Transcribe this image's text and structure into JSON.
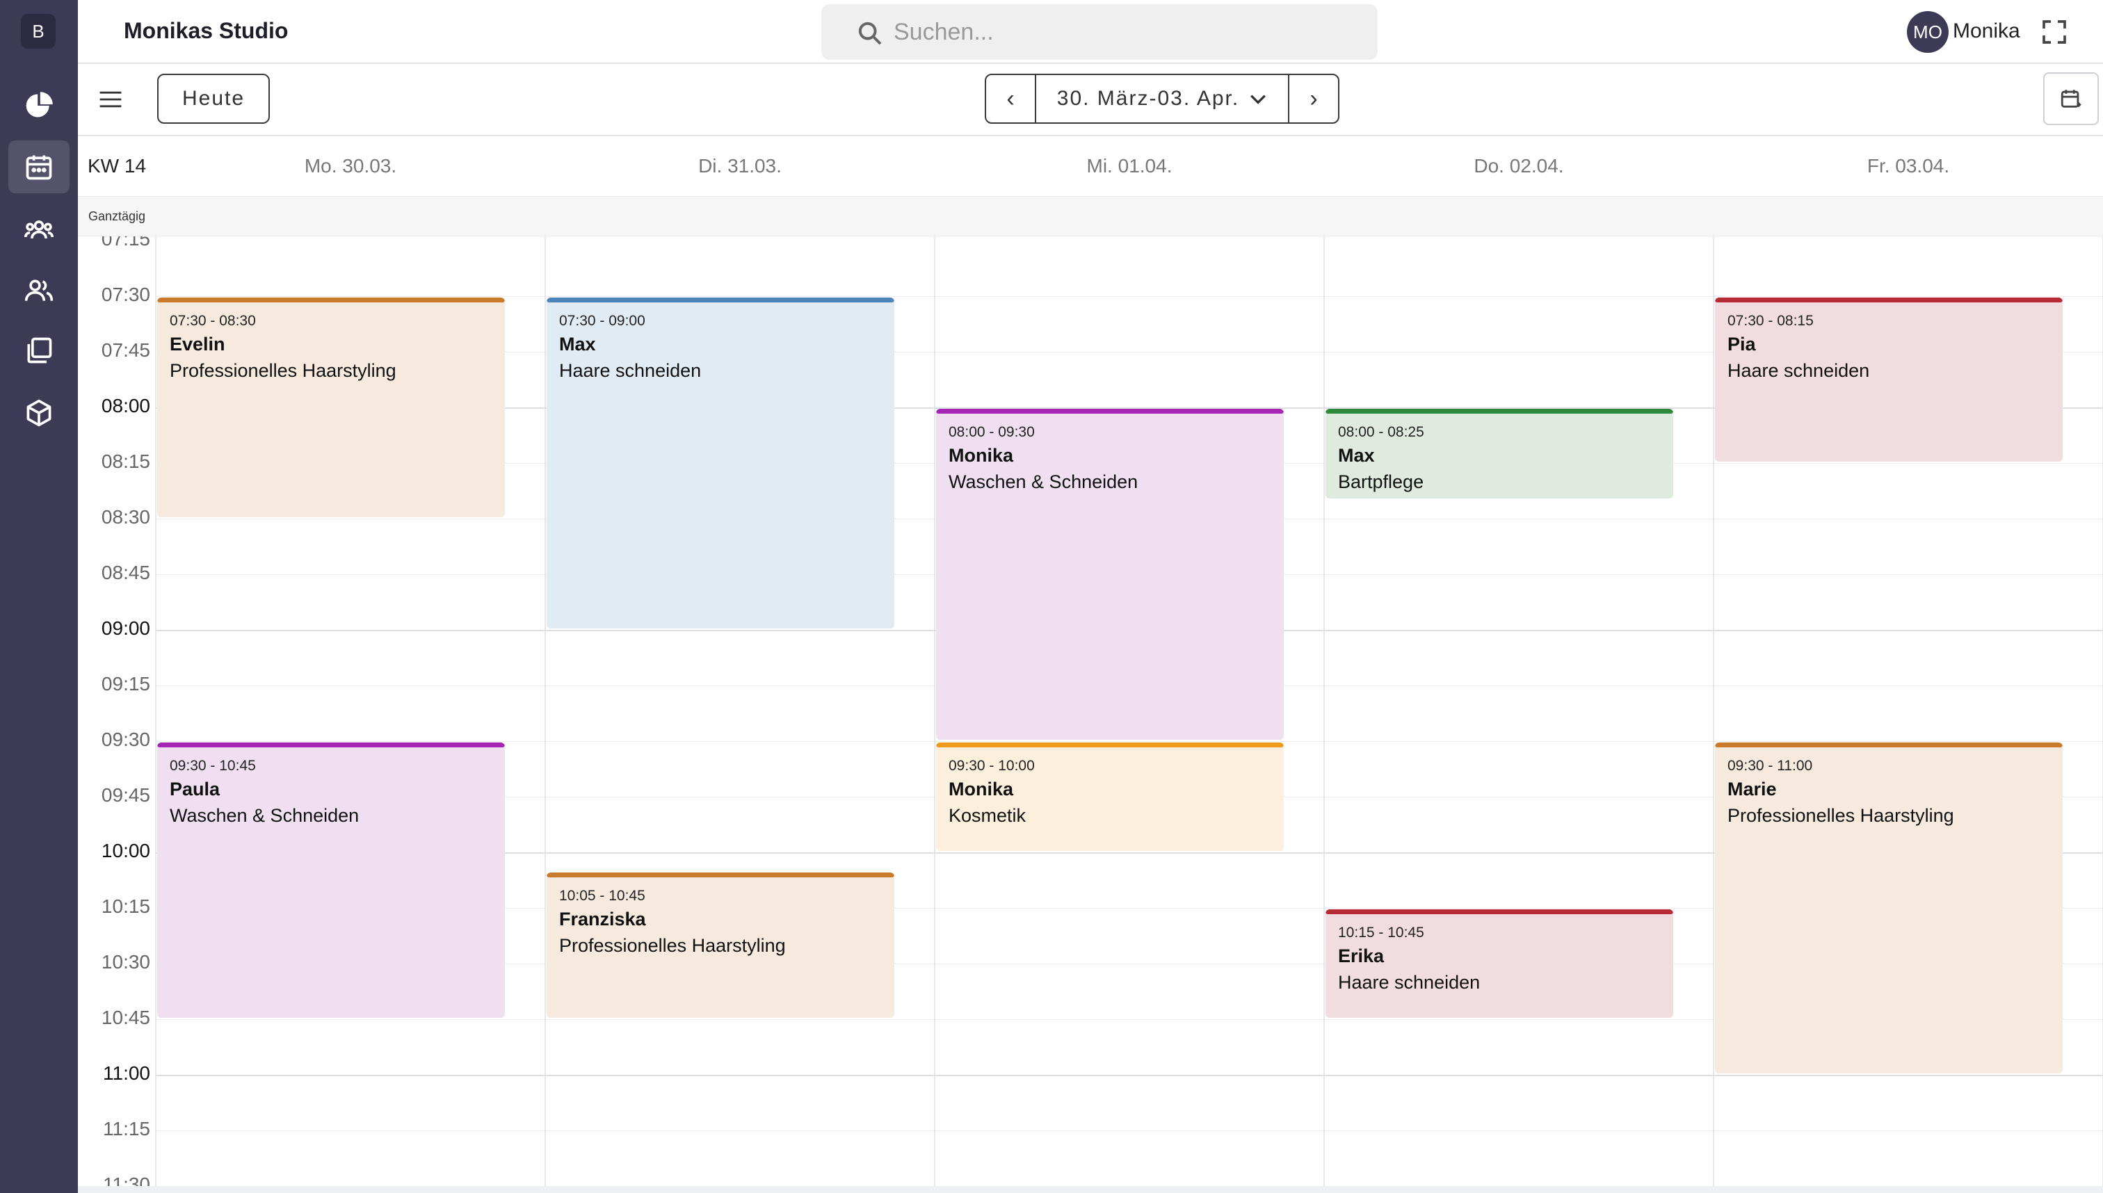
{
  "app": {
    "brand_letter": "B",
    "studio_name": "Monikas Studio"
  },
  "nav": {
    "items": [
      {
        "icon": "pie-chart-icon"
      },
      {
        "icon": "calendar-icon",
        "active": true
      },
      {
        "icon": "customers-icon"
      },
      {
        "icon": "team-icon"
      },
      {
        "icon": "copy-icon"
      },
      {
        "icon": "cube-icon"
      }
    ]
  },
  "search": {
    "placeholder": "Suchen..."
  },
  "user": {
    "initials": "MO",
    "name": "Monika"
  },
  "toolbar": {
    "today_label": "Heute",
    "date_range": "30. März-03. Apr.",
    "prev_label": "‹",
    "next_label": "›"
  },
  "calendar": {
    "week_label": "KW 14",
    "allday_label": "Ganztägig",
    "days": [
      "Mo. 30.03.",
      "Di. 31.03.",
      "Mi. 01.04.",
      "Do. 02.04.",
      "Fr. 03.04."
    ],
    "time_slots": [
      "07:15",
      "07:30",
      "07:45",
      "08:00",
      "08:15",
      "08:30",
      "08:45",
      "09:00",
      "09:15",
      "09:30",
      "09:45",
      "10:00",
      "10:15",
      "10:30",
      "10:45",
      "11:00",
      "11:15",
      "11:30"
    ],
    "colors": {
      "orange": "#c97a2b",
      "blue": "#4a84b8",
      "purple": "#a327b2",
      "green": "#2f8a3c",
      "red": "#b52a35",
      "amber": "#ee9a1a"
    },
    "events": [
      {
        "day": 0,
        "start": "07:30",
        "end": "08:30",
        "time": "07:30 - 08:30",
        "name": "Evelin",
        "service": "Professionelles Haarstyling",
        "bar_color": "#c97a2b",
        "bg_color": "#f6e9dd"
      },
      {
        "day": 0,
        "start": "09:30",
        "end": "10:45",
        "time": "09:30 - 10:45",
        "name": "Paula",
        "service": "Waschen & Schneiden",
        "bar_color": "#a327b2",
        "bg_color": "#efdff0"
      },
      {
        "day": 1,
        "start": "07:30",
        "end": "09:00",
        "time": "07:30 - 09:00",
        "name": "Max",
        "service": "Haare schneiden",
        "bar_color": "#4a84b8",
        "bg_color": "#e1ebf4"
      },
      {
        "day": 1,
        "start": "10:05",
        "end": "10:45",
        "time": "10:05 - 10:45",
        "name": "Franziska",
        "service": "Professionelles Haarstyling",
        "bar_color": "#c97a2b",
        "bg_color": "#f6e9dd"
      },
      {
        "day": 2,
        "start": "08:00",
        "end": "09:30",
        "time": "08:00 - 09:30",
        "name": "Monika",
        "service": "Waschen & Schneiden",
        "bar_color": "#a327b2",
        "bg_color": "#efdff0"
      },
      {
        "day": 2,
        "start": "09:30",
        "end": "10:00",
        "time": "09:30 - 10:00",
        "name": "Monika",
        "service": "Kosmetik",
        "bar_color": "#ee9a1a",
        "bg_color": "#fcefdc"
      },
      {
        "day": 3,
        "start": "08:00",
        "end": "08:25",
        "time": "08:00 - 08:25",
        "name": "Max",
        "service": "Bartpflege",
        "bar_color": "#2f8a3c",
        "bg_color": "#e0ebe0"
      },
      {
        "day": 3,
        "start": "10:15",
        "end": "10:45",
        "time": "10:15 - 10:45",
        "name": "Erika",
        "service": "Haare schneiden",
        "bar_color": "#b52a35",
        "bg_color": "#f1dcdf"
      },
      {
        "day": 4,
        "start": "07:30",
        "end": "08:15",
        "time": "07:30 - 08:15",
        "name": "Pia",
        "service": "Haare schneiden",
        "bar_color": "#b52a35",
        "bg_color": "#f1dcdf"
      },
      {
        "day": 4,
        "start": "09:30",
        "end": "11:00",
        "time": "09:30 - 11:00",
        "name": "Marie",
        "service": "Professionelles Haarstyling",
        "bar_color": "#c97a2b",
        "bg_color": "#f6e9dd"
      }
    ]
  }
}
